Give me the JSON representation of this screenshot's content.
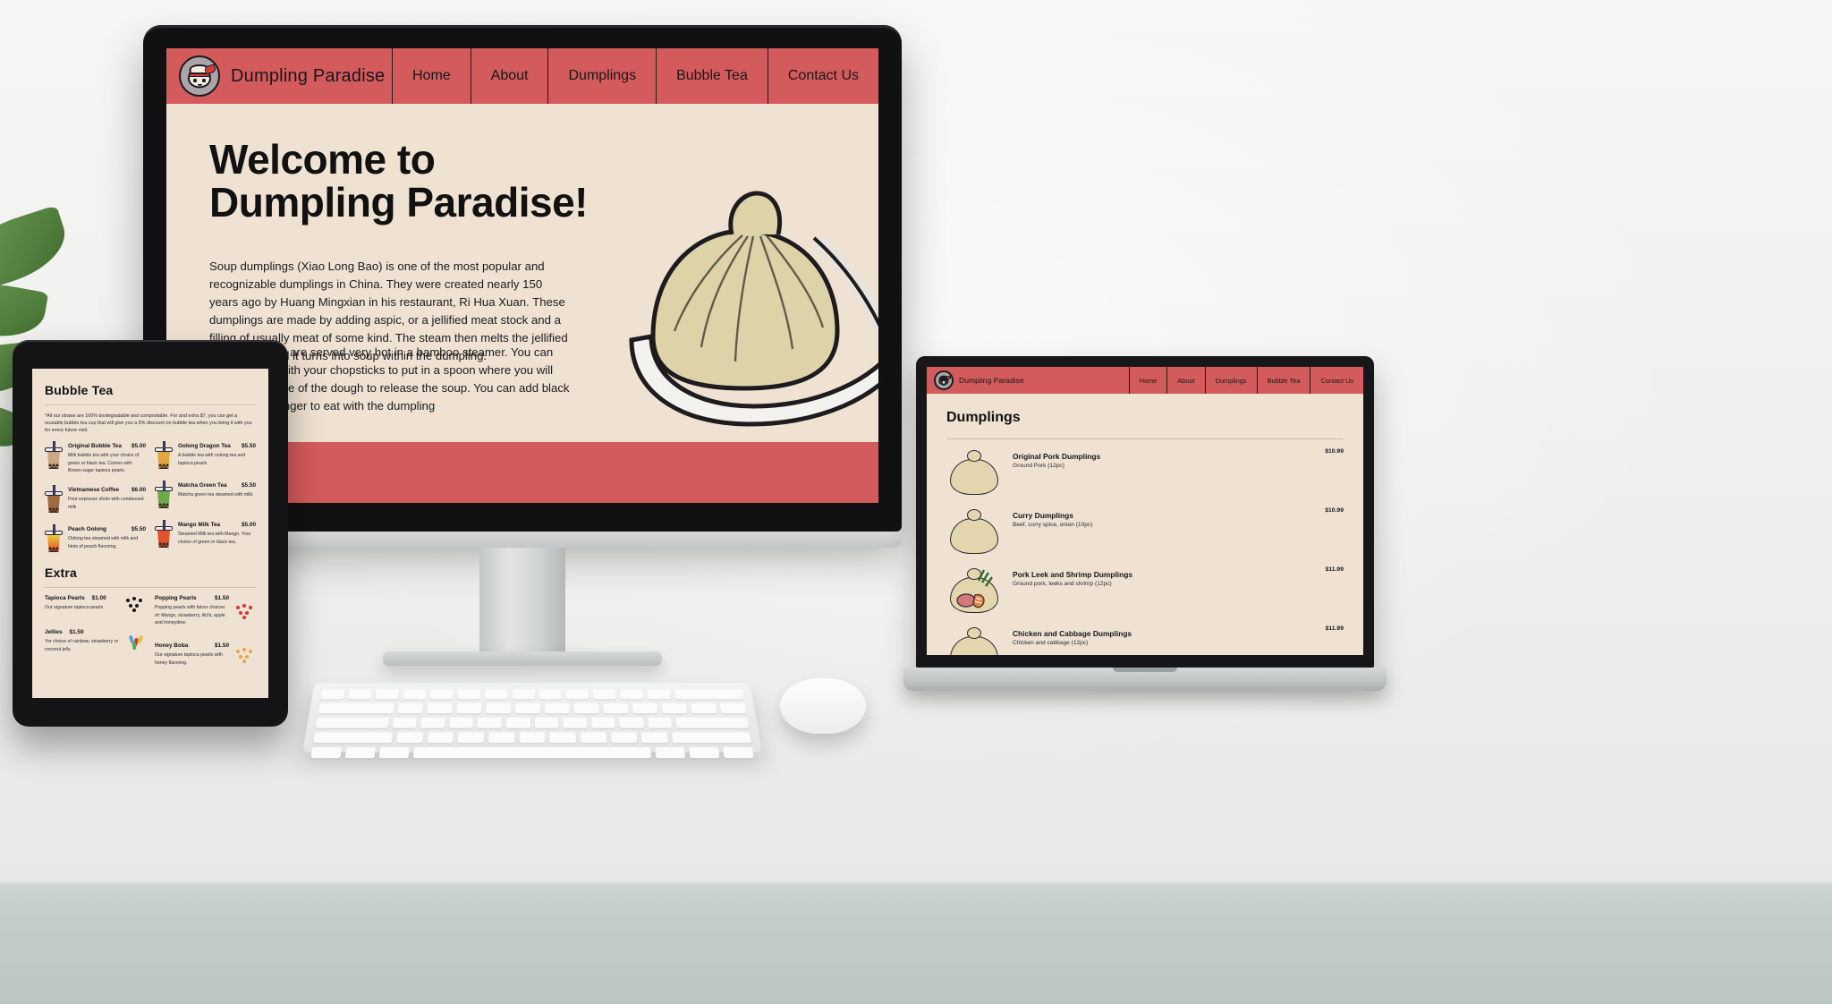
{
  "site": {
    "brand": "Dumpling Paradise",
    "logo_icon": "dumpling-mascot-icon",
    "colors": {
      "accent_red": "#d45b5b",
      "page_cream": "#efe2d3",
      "text_dark": "#17161a",
      "logo_grey": "#a9a5a8"
    },
    "nav": [
      {
        "label": "Home"
      },
      {
        "label": "About"
      },
      {
        "label": "Dumplings"
      },
      {
        "label": "Bubble Tea"
      },
      {
        "label": "Contact Us"
      }
    ]
  },
  "monitor": {
    "hero": {
      "title_line1": "Welcome to",
      "title_line2": "Dumpling Paradise!",
      "paragraph1": "Soup dumplings (Xiao Long Bao) is one of the most popular and recognizable dumplings in China. They were created nearly 150 years ago by Huang Mingxian in his restaurant, Ri Hua Xuan. These dumplings are made by adding aspic, or a jellified meat stock and a filling of usually meat of some kind. The steam then melts the jellified meat stock and it turns into soup within the dumpling.",
      "paragraph2": "Xiao Long Bao are served very hot in a bamboo steamer. You can pick them up with your chopsticks to put in a spoon where you will take a small bite of the dough to release the soup. You can add black vinegar and ginger to eat with the dumpling",
      "image_alt": "soup-dumpling-on-spoon-illustration"
    }
  },
  "tablet": {
    "bubble_tea": {
      "heading": "Bubble Tea",
      "note": "*All our straws are 100% biodegradable and compostable. For and extra $7, you can get a reusable bubble tea cup that will give you a 5% discount on bubble tea when you bring it with you for every future visit.",
      "items_left": [
        {
          "name": "Original Bubble Tea",
          "price": "$5.00",
          "desc": "Milk bubble tea with your choice of green or black tea. Comes with Brown sugar tapioca pearls.",
          "cup_color": "#c9a882",
          "icon": "boba-cup-icon"
        },
        {
          "name": "Vietnamese Coffee",
          "price": "$6.00",
          "desc": "Four espresso shots with condensed milk",
          "cup_color": "#9d6b3f",
          "icon": "boba-cup-icon"
        },
        {
          "name": "Peach Oolong",
          "price": "$5.50",
          "desc": "Oolong tea steamed with milk and hints of peach flavoring.",
          "cup_color": "#e8a33c",
          "icon": "boba-cup-icon"
        }
      ],
      "items_right": [
        {
          "name": "Oolong Dragon Tea",
          "price": "$5.50",
          "desc": "A bubble tea with oolong tea and tapioca pearls",
          "cup_color": "#e4a63f",
          "icon": "boba-cup-icon"
        },
        {
          "name": "Matcha Green Tea",
          "price": "$5.50",
          "desc": "Matcha green tea steamed with milk.",
          "cup_color": "#6fa84a",
          "icon": "boba-cup-icon"
        },
        {
          "name": "Mango Milk Tea",
          "price": "$5.00",
          "desc": "Steamed Milk tea with Mango. Your choice of green or black tea.",
          "cup_color": "#e2522b",
          "icon": "boba-cup-icon"
        }
      ]
    },
    "extra": {
      "heading": "Extra",
      "items_left": [
        {
          "name": "Tapioca Pearls",
          "price": "$1.00",
          "desc": "Our signature tapioca pearls",
          "icon": "pearl-cluster-icon",
          "dot_color": "#1a1718"
        },
        {
          "name": "Jellies",
          "price": "$1.50",
          "desc": "Yor choice of rainbow, strawberry or coconut jelly.",
          "icon": "jelly-sticks-icon",
          "dot_color": "#4aa3d8"
        }
      ],
      "items_right": [
        {
          "name": "Popping Pearls",
          "price": "$1.50",
          "desc": "Popping pearls with falvor choices of: Mango, strawberry, litchi, apple and honeydew.",
          "icon": "pearl-cluster-icon",
          "dot_color": "#d43535"
        },
        {
          "name": "Honey Boba",
          "price": "$1.50",
          "desc": "Our signature tapioca pearls with honey flavoring.",
          "icon": "pearl-cluster-icon",
          "dot_color": "#e8a445"
        }
      ]
    }
  },
  "laptop": {
    "dumplings": {
      "heading": "Dumplings",
      "items": [
        {
          "name": "Original Pork Dumplings",
          "desc": "Ground Pork (12pc)",
          "price": "$10.99",
          "icon": "dumpling-icon"
        },
        {
          "name": "Curry Dumplings",
          "desc": "Beef, curry spice, onion (10pc)",
          "price": "$10.99",
          "icon": "dumpling-icon"
        },
        {
          "name": "Pork Leek and Shrimp Dumplings",
          "desc": "Ground pork, leeks and shrimp (12pc)",
          "price": "$11.99",
          "icon": "dumpling-with-fillings-icon"
        },
        {
          "name": "Chicken and Cabbage Dumplings",
          "desc": "Chicken and cabbage (12pc)",
          "price": "$11.99",
          "icon": "dumpling-icon"
        }
      ]
    }
  }
}
